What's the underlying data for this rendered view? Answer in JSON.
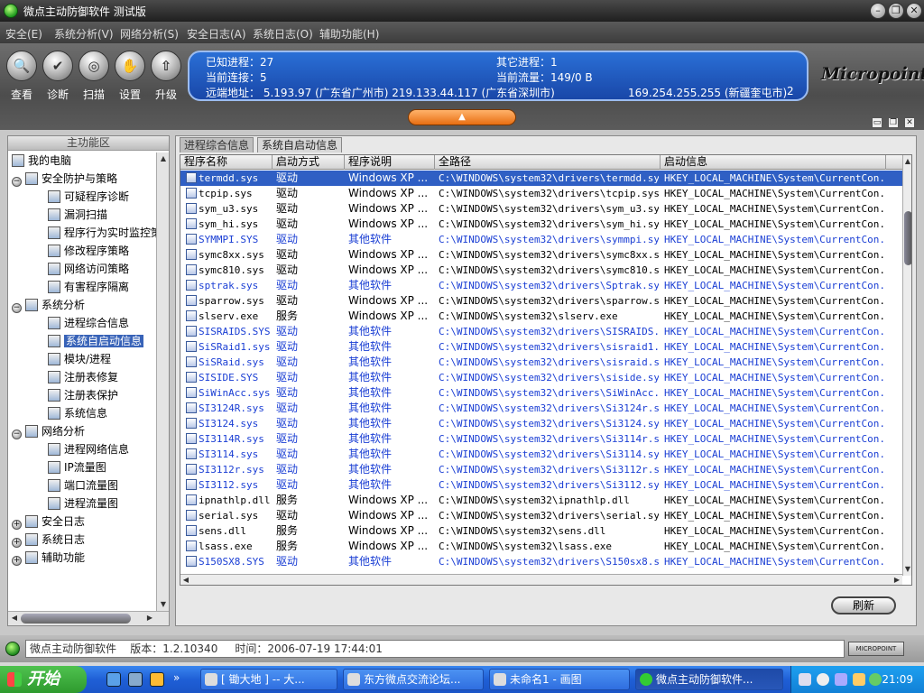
{
  "window": {
    "title": "微点主动防御软件  测试版",
    "minimize": "–",
    "restore": "❐",
    "close": "✕"
  },
  "menu": [
    "安全(E)",
    "系统分析(V)",
    "网络分析(S)",
    "安全日志(A)",
    "系统日志(O)",
    "辅助功能(H)"
  ],
  "toolbar": [
    {
      "label": "查看",
      "icon": "magnifier-icon",
      "glyph": "🔍"
    },
    {
      "label": "诊断",
      "icon": "shield-check-icon",
      "glyph": "✔"
    },
    {
      "label": "扫描",
      "icon": "scan-icon",
      "glyph": "◎"
    },
    {
      "label": "设置",
      "icon": "hand-settings-icon",
      "glyph": "✋"
    },
    {
      "label": "升级",
      "icon": "upgrade-icon",
      "glyph": "⇧"
    }
  ],
  "info": {
    "known_process": "已知进程：27",
    "other_process": "其它进程：1",
    "current_conn": "当前连接：5",
    "current_traffic": "当前流量：149/0 B",
    "remote_addr": "远端地址： 5.193.97 (广东省广州市)     219.133.44.117 (广东省深圳市)",
    "remote_addr_2": "169.254.255.255 (新疆奎屯市)",
    "remote_count": "2"
  },
  "logo": "Micropoint",
  "left_panel": {
    "header": "主功能区",
    "tree": [
      {
        "label": "我的电脑",
        "level": 0,
        "icon": "computer-icon",
        "expander": ""
      },
      {
        "label": "安全防护与策略",
        "level": 1,
        "icon": "policy-icon",
        "expander": "−"
      },
      {
        "label": "可疑程序诊断",
        "level": 2,
        "icon": "diagnose-icon",
        "expander": ""
      },
      {
        "label": "漏洞扫描",
        "level": 2,
        "icon": "magnifier-icon",
        "expander": ""
      },
      {
        "label": "程序行为实时监控策",
        "level": 2,
        "icon": "monitor-icon",
        "expander": ""
      },
      {
        "label": "修改程序策略",
        "level": 2,
        "icon": "edit-icon",
        "expander": ""
      },
      {
        "label": "网络访问策略",
        "level": 2,
        "icon": "network-icon",
        "expander": ""
      },
      {
        "label": "有害程序隔离",
        "level": 2,
        "icon": "quarantine-icon",
        "expander": ""
      },
      {
        "label": "系统分析",
        "level": 1,
        "icon": "system-icon",
        "expander": "−"
      },
      {
        "label": "进程综合信息",
        "level": 2,
        "icon": "process-icon",
        "expander": ""
      },
      {
        "label": "系统自启动信息",
        "level": 2,
        "icon": "startup-icon",
        "expander": "",
        "selected": true
      },
      {
        "label": "模块/进程",
        "level": 2,
        "icon": "module-icon",
        "expander": ""
      },
      {
        "label": "注册表修复",
        "level": 2,
        "icon": "registry-icon",
        "expander": ""
      },
      {
        "label": "注册表保护",
        "level": 2,
        "icon": "registry-protect-icon",
        "expander": ""
      },
      {
        "label": "系统信息",
        "level": 2,
        "icon": "info-icon",
        "expander": ""
      },
      {
        "label": "网络分析",
        "level": 1,
        "icon": "network-analysis-icon",
        "expander": "−"
      },
      {
        "label": "进程网络信息",
        "level": 2,
        "icon": "process-network-icon",
        "expander": ""
      },
      {
        "label": "IP流量图",
        "level": 2,
        "icon": "chart-icon",
        "expander": ""
      },
      {
        "label": "端口流量图",
        "level": 2,
        "icon": "chart-icon",
        "expander": ""
      },
      {
        "label": "进程流量图",
        "level": 2,
        "icon": "chart-icon",
        "expander": ""
      },
      {
        "label": "安全日志",
        "level": 1,
        "icon": "log-icon",
        "expander": "+"
      },
      {
        "label": "系统日志",
        "level": 1,
        "icon": "log-icon",
        "expander": "+"
      },
      {
        "label": "辅助功能",
        "level": 1,
        "icon": "tools-icon",
        "expander": "+"
      }
    ]
  },
  "tabs": [
    {
      "label": "进程综合信息",
      "active": false
    },
    {
      "label": "系统自启动信息",
      "active": true
    }
  ],
  "table": {
    "columns": [
      "程序名称",
      "启动方式",
      "程序说明",
      "全路径",
      "启动信息"
    ],
    "rows": [
      [
        "termdd.sys",
        "驱动",
        "Windows XP ...",
        "C:\\WINDOWS\\system32\\drivers\\termdd.sys",
        "HKEY_LOCAL_MACHINE\\System\\CurrentCon...",
        "sel"
      ],
      [
        "tcpip.sys",
        "驱动",
        "Windows XP ...",
        "C:\\WINDOWS\\system32\\drivers\\tcpip.sys",
        "HKEY_LOCAL_MACHINE\\System\\CurrentCon...",
        ""
      ],
      [
        "sym_u3.sys",
        "驱动",
        "Windows XP ...",
        "C:\\WINDOWS\\system32\\drivers\\sym_u3.sys",
        "HKEY_LOCAL_MACHINE\\System\\CurrentCon...",
        ""
      ],
      [
        "sym_hi.sys",
        "驱动",
        "Windows XP ...",
        "C:\\WINDOWS\\system32\\drivers\\sym_hi.sys",
        "HKEY_LOCAL_MACHINE\\System\\CurrentCon...",
        ""
      ],
      [
        "SYMMPI.SYS",
        "驱动",
        "其他软件",
        "C:\\WINDOWS\\system32\\drivers\\symmpi.sys",
        "HKEY_LOCAL_MACHINE\\System\\CurrentCon...",
        "blue"
      ],
      [
        "symc8xx.sys",
        "驱动",
        "Windows XP ...",
        "C:\\WINDOWS\\system32\\drivers\\symc8xx.sys",
        "HKEY_LOCAL_MACHINE\\System\\CurrentCon...",
        ""
      ],
      [
        "symc810.sys",
        "驱动",
        "Windows XP ...",
        "C:\\WINDOWS\\system32\\drivers\\symc810.sys",
        "HKEY_LOCAL_MACHINE\\System\\CurrentCon...",
        ""
      ],
      [
        "sptrak.sys",
        "驱动",
        "其他软件",
        "C:\\WINDOWS\\system32\\drivers\\Sptrak.sys",
        "HKEY_LOCAL_MACHINE\\System\\CurrentCon...",
        "blue"
      ],
      [
        "sparrow.sys",
        "驱动",
        "Windows XP ...",
        "C:\\WINDOWS\\system32\\drivers\\sparrow.sys",
        "HKEY_LOCAL_MACHINE\\System\\CurrentCon...",
        ""
      ],
      [
        "slserv.exe",
        "服务",
        "Windows XP ...",
        "C:\\WINDOWS\\system32\\slserv.exe",
        "HKEY_LOCAL_MACHINE\\System\\CurrentCon...",
        ""
      ],
      [
        "SISRAIDS.SYS",
        "驱动",
        "其他软件",
        "C:\\WINDOWS\\system32\\drivers\\SISRAIDS...",
        "HKEY_LOCAL_MACHINE\\System\\CurrentCon...",
        "blue"
      ],
      [
        "SiSRaid1.sys",
        "驱动",
        "其他软件",
        "C:\\WINDOWS\\system32\\drivers\\sisraid1...",
        "HKEY_LOCAL_MACHINE\\System\\CurrentCon...",
        "blue"
      ],
      [
        "SiSRaid.sys",
        "驱动",
        "其他软件",
        "C:\\WINDOWS\\system32\\drivers\\sisraid.sys",
        "HKEY_LOCAL_MACHINE\\System\\CurrentCon...",
        "blue"
      ],
      [
        "SISIDE.SYS",
        "驱动",
        "其他软件",
        "C:\\WINDOWS\\system32\\drivers\\siside.sys",
        "HKEY_LOCAL_MACHINE\\System\\CurrentCon...",
        "blue"
      ],
      [
        "SiWinAcc.sys",
        "驱动",
        "其他软件",
        "C:\\WINDOWS\\system32\\drivers\\SiWinAcc...",
        "HKEY_LOCAL_MACHINE\\System\\CurrentCon...",
        "blue"
      ],
      [
        "SI3124R.sys",
        "驱动",
        "其他软件",
        "C:\\WINDOWS\\system32\\drivers\\Si3124r.sys",
        "HKEY_LOCAL_MACHINE\\System\\CurrentCon...",
        "blue"
      ],
      [
        "SI3124.sys",
        "驱动",
        "其他软件",
        "C:\\WINDOWS\\system32\\drivers\\Si3124.sys",
        "HKEY_LOCAL_MACHINE\\System\\CurrentCon...",
        "blue"
      ],
      [
        "SI3114R.sys",
        "驱动",
        "其他软件",
        "C:\\WINDOWS\\system32\\drivers\\Si3114r.sys",
        "HKEY_LOCAL_MACHINE\\System\\CurrentCon...",
        "blue"
      ],
      [
        "SI3114.sys",
        "驱动",
        "其他软件",
        "C:\\WINDOWS\\system32\\drivers\\Si3114.sys",
        "HKEY_LOCAL_MACHINE\\System\\CurrentCon...",
        "blue"
      ],
      [
        "SI3112r.sys",
        "驱动",
        "其他软件",
        "C:\\WINDOWS\\system32\\drivers\\Si3112r.sys",
        "HKEY_LOCAL_MACHINE\\System\\CurrentCon...",
        "blue"
      ],
      [
        "SI3112.sys",
        "驱动",
        "其他软件",
        "C:\\WINDOWS\\system32\\drivers\\Si3112.sys",
        "HKEY_LOCAL_MACHINE\\System\\CurrentCon...",
        "blue"
      ],
      [
        "ipnathlp.dll",
        "服务",
        "Windows XP ...",
        "C:\\WINDOWS\\system32\\ipnathlp.dll",
        "HKEY_LOCAL_MACHINE\\System\\CurrentCon...",
        ""
      ],
      [
        "serial.sys",
        "驱动",
        "Windows XP ...",
        "C:\\WINDOWS\\system32\\drivers\\serial.sys",
        "HKEY_LOCAL_MACHINE\\System\\CurrentCon...",
        ""
      ],
      [
        "sens.dll",
        "服务",
        "Windows XP ...",
        "C:\\WINDOWS\\system32\\sens.dll",
        "HKEY_LOCAL_MACHINE\\System\\CurrentCon...",
        ""
      ],
      [
        "lsass.exe",
        "服务",
        "Windows XP ...",
        "C:\\WINDOWS\\system32\\lsass.exe",
        "HKEY_LOCAL_MACHINE\\System\\CurrentCon...",
        ""
      ],
      [
        "S150SX8.SYS",
        "驱动",
        "其他软件",
        "C:\\WINDOWS\\system32\\drivers\\S150sx8.sys",
        "HKEY_LOCAL_MACHINE\\System\\CurrentCon...",
        "blue"
      ]
    ]
  },
  "refresh_label": "刷新",
  "status": {
    "text": "微点主动防御软件    版本：1.2.10340     时间：2006-07-19 17:44:01",
    "brand": "MICROPOINT"
  },
  "taskbar": {
    "start": "开始",
    "more": "»",
    "tasks": [
      {
        "label": "[ 锄大地 ] -- 大...",
        "active": false
      },
      {
        "label": "东方微点交流论坛...",
        "active": false
      },
      {
        "label": "未命名1 - 画图",
        "active": false
      },
      {
        "label": "微点主动防御软件...",
        "active": true
      }
    ],
    "clock": "21:09"
  },
  "colors": {
    "selection": "#2f5fc4",
    "other_software_text": "#1a3ed4",
    "info_panel": "#1f5cc4",
    "collapse_button": "#f07a1e"
  }
}
